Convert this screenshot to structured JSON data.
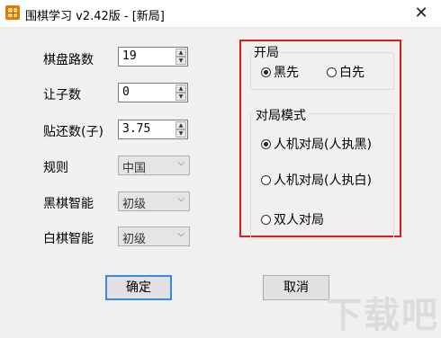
{
  "window": {
    "title": "围棋学习 v2.42版 - [新局]",
    "close_symbol": "✕"
  },
  "settings": {
    "board_size": {
      "label": "棋盘路数",
      "value": "19"
    },
    "handicap": {
      "label": "让子数",
      "value": "0"
    },
    "komi": {
      "label": "贴还数(子)",
      "value": "3.75"
    },
    "rules": {
      "label": "规则",
      "value": "中国"
    },
    "black_ai": {
      "label": "黑棋智能",
      "value": "初级"
    },
    "white_ai": {
      "label": "白棋智能",
      "value": "初级"
    }
  },
  "opening": {
    "title": "开局",
    "options": [
      "黑先",
      "白先"
    ],
    "selected": "黑先"
  },
  "mode": {
    "title": "对局模式",
    "options": [
      "人机对局(人执黑)",
      "人机对局(人执白)",
      "双人对局"
    ],
    "selected": "人机对局(人执黑)"
  },
  "buttons": {
    "ok": "确定",
    "cancel": "取消"
  },
  "watermark": "下载吧",
  "colors": {
    "highlight_box": "#e21b1b",
    "default_button_border": "#3a8be0"
  }
}
